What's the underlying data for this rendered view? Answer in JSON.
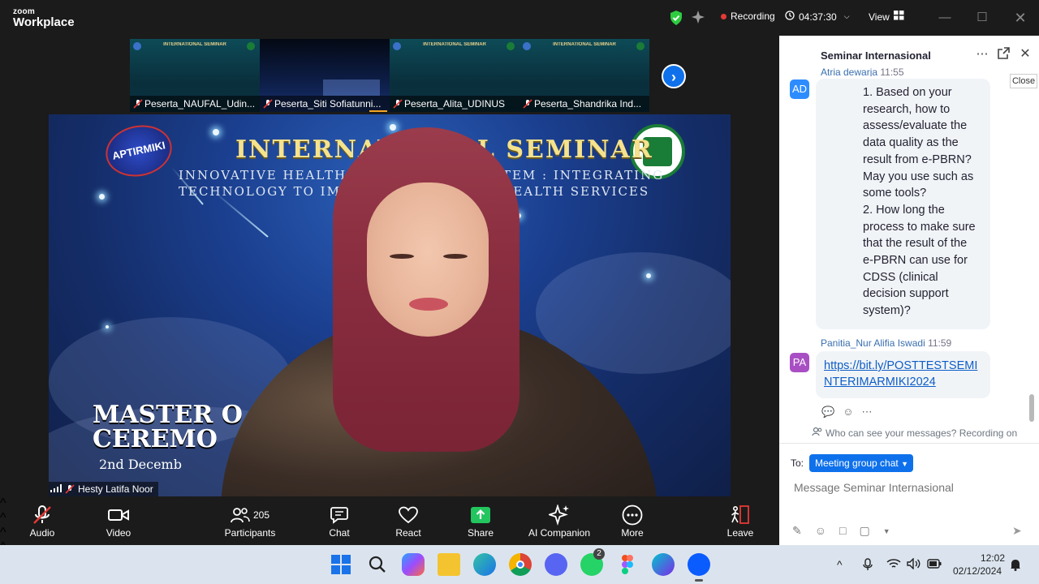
{
  "window": {
    "brand_top": "zoom",
    "brand_bottom": "Workplace",
    "recording_label": "Recording",
    "timer": "04:37:30",
    "view_label": "View",
    "colors": {
      "recording_dot": "#e53935",
      "shield": "#2ecc40",
      "accent": "#0e71eb"
    }
  },
  "thumbnails": [
    {
      "name": "Peserta_NAUFAL_Udin...",
      "title": "INTERNATIONAL SEMINAR",
      "muted": true
    },
    {
      "name": "Peserta_Siti Sofiatunni...",
      "title": "",
      "muted": true
    },
    {
      "name": "Peserta_Alita_UDINUS",
      "title": "INTERNATIONAL SEMINAR",
      "muted": true
    },
    {
      "name": "Peserta_Shandrika Ind...",
      "title": "INTERNATIONAL SEMINAR",
      "muted": true
    }
  ],
  "speaker": {
    "name": "Hesty Latifa Noor",
    "background": {
      "logo_left": "APTIRMIKI",
      "title": "INTERNATIONAL SEMINAR",
      "subtitle_line1": "INNOVATIVE HEALTH INFORMATION SYSTEM : INTEGRATING",
      "subtitle_line2": "TECHNOLOGY TO IMPROVE QUALITY OF HEALTH SERVICES",
      "master_line1": "MASTER O",
      "master_line2": "CEREMO",
      "date": "2nd Decemb"
    }
  },
  "toolbar": {
    "audio": "Audio",
    "video": "Video",
    "participants": "Participants",
    "participants_count": "205",
    "chat": "Chat",
    "react": "React",
    "share": "Share",
    "ai_companion": "AI Companion",
    "more": "More",
    "leave": "Leave"
  },
  "chat": {
    "title": "Seminar Internasional",
    "close_tooltip": "Close",
    "messages": [
      {
        "initials": "AD",
        "sender": "Atria dewarja",
        "time": "11:55",
        "avatar_color": "#2d8cff",
        "lines": [
          "1.     Based on your",
          "research, how to",
          "assess/evaluate the",
          "data quality as the",
          "result from e-PBRN?",
          "May you use such as",
          "some tools?",
          "2.     How long the",
          "process to make sure",
          "that the result of the",
          "e-PBRN can use for",
          "CDSS (clinical",
          "decision support",
          "system)?"
        ]
      },
      {
        "initials": "PA",
        "sender": "Panitia_Nur Alifia Iswadi",
        "time": "11:59",
        "avatar_color": "#a94fc4",
        "link_lines": [
          "https://bit.ly/POSTTESTSEMI",
          "NTERIMARMIKI2024"
        ]
      }
    ],
    "privacy_note": "Who can see your messages? Recording on",
    "to_label": "To:",
    "recipient": "Meeting group chat",
    "input_placeholder": "Message Seminar Internasional"
  },
  "taskbar": {
    "whatsapp_badge": "2",
    "time": "12:02",
    "date": "02/12/2024"
  }
}
